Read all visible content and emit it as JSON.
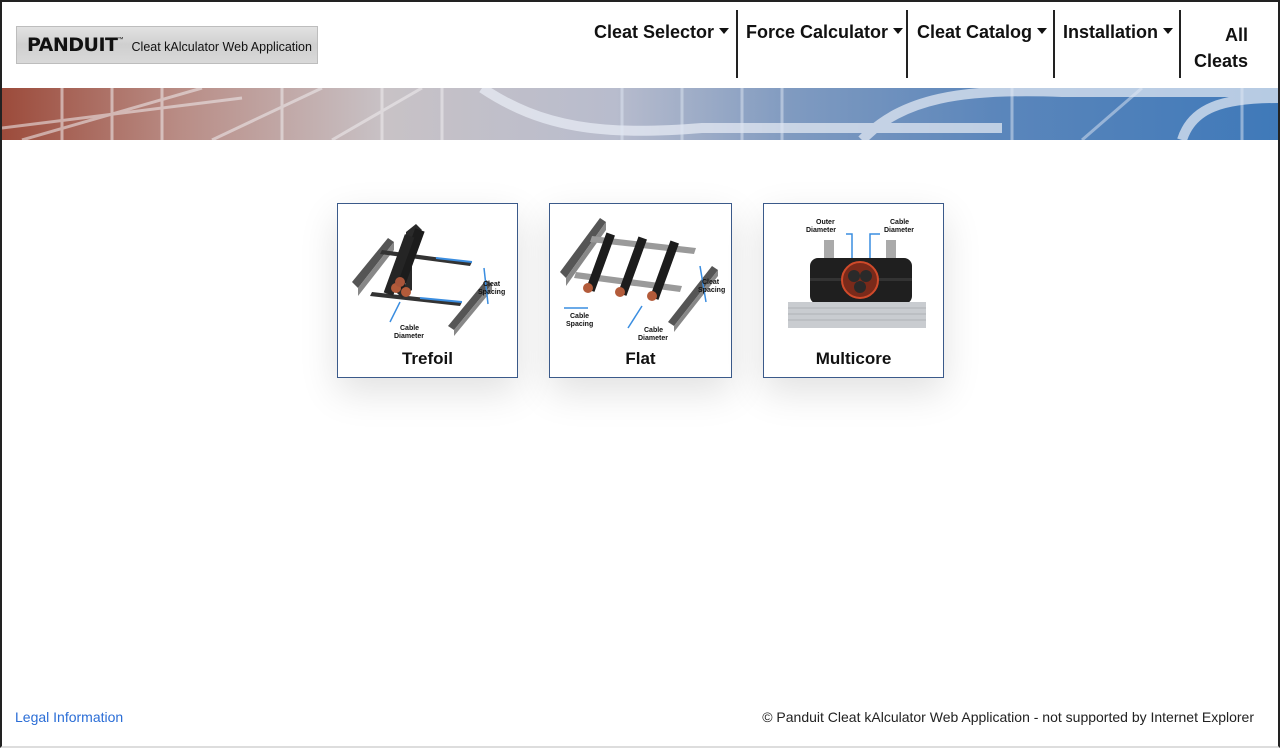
{
  "logo": {
    "brand": "PANDUIT",
    "app_name": "Cleat kAlculator Web Application"
  },
  "nav": {
    "cleat_selector": "Cleat Selector",
    "force_calculator": "Force Calculator",
    "cleat_catalog": "Cleat Catalog",
    "installation": "Installation",
    "all_cleats_line1": "All",
    "all_cleats_line2": "Cleats"
  },
  "cards": [
    {
      "title": "Trefoil",
      "labels": [
        "Cleat",
        "Spacing",
        "Cable",
        "Diameter"
      ]
    },
    {
      "title": "Flat",
      "labels": [
        "Cleat",
        "Spacing",
        "Cable",
        "Spacing",
        "Cable",
        "Diameter"
      ]
    },
    {
      "title": "Multicore",
      "labels": [
        "Outer",
        "Diameter",
        "Cable",
        "Diameter"
      ]
    }
  ],
  "footer": {
    "legal": "Legal Information",
    "copyright": "© Panduit Cleat kAlculator Web Application - not supported by Internet Explorer"
  },
  "colors": {
    "accent_link": "#2a6dd6",
    "card_border": "#3b5a8a",
    "dimension_line": "#3a8de0"
  }
}
